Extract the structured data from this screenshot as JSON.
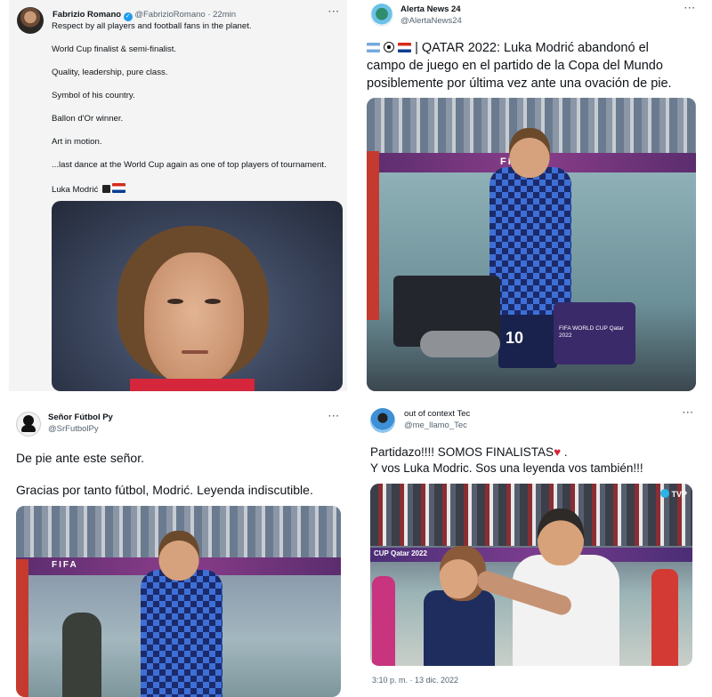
{
  "tweets": [
    {
      "name": "Fabrizio Romano",
      "handle": "@FabrizioRomano",
      "time": "· 22min",
      "lines": [
        "Respect by all players and football fans in the planet.",
        "World Cup finalist & semi-finalist.",
        "Quality, leadership, pure class.",
        "Symbol of his country.",
        "Ballon d'Or winner.",
        "Art in motion.",
        "...last dance at the World Cup again as one of top players of tournament.",
        "Luka Modrić"
      ],
      "verified_icon": "verified-badge-icon",
      "emojis": [
        "top-hat-icon",
        "croatia-flag-icon"
      ]
    },
    {
      "name": "Alerta News 24",
      "handle": "@AlertaNews24",
      "text_line1": "| QATAR 2022: Luka Modrić abandonó el",
      "text_line2": "campo de juego en el partido de la Copa del Mundo",
      "text_line3": "posiblemente por última vez ante una ovación de pie.",
      "emojis": [
        "argentina-flag-icon",
        "soccer-ball-icon",
        "croatia-flag-icon"
      ],
      "banner_text": "FIFA",
      "camera_text": "FIFA WORLD CUP Qatar 2022",
      "shirt_number": "10"
    },
    {
      "name": "Señor Fútbol Py",
      "handle": "@SrFutbolPy",
      "line1": "De pie ante este señor.",
      "line2": "Gracias por tanto fútbol, Modrić. Leyenda indiscutible.",
      "banner_text": "FIFA"
    },
    {
      "name": "out of context Tec",
      "handle": "@me_llamo_Tec",
      "line1": "Partidazo!!!! SOMOS FINALISTAS",
      "line2": "Y vos Luka Modric. Sos una leyenda vos también!!!",
      "heart_icon": "red-heart-icon",
      "tv_logo": "TVP",
      "board_text": "CUP Qatar 2022",
      "timestamp": "3:10 p. m. · 13 dic. 2022"
    }
  ],
  "more_label": "···"
}
